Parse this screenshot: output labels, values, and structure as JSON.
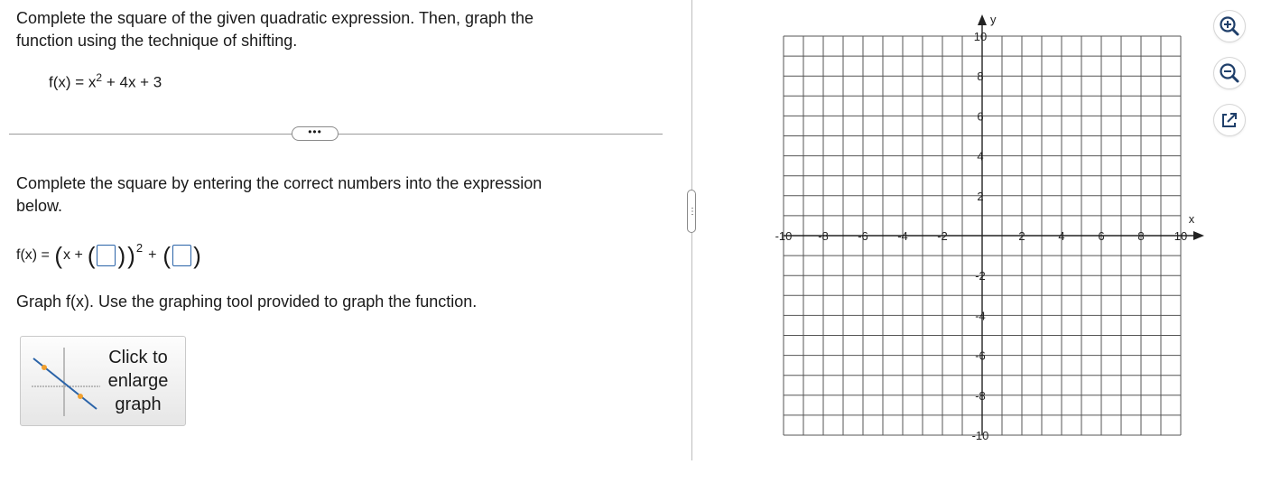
{
  "question": {
    "instruction_line1": "Complete the square of the given quadratic expression. Then, graph the",
    "instruction_line2": "function using the technique of shifting.",
    "function_lhs": "f(x) = x",
    "function_exp": "2",
    "function_rest": " + 4x + 3",
    "more_label": "•••",
    "step1_line1": "Complete the square by entering the correct numbers into the expression",
    "step1_line2": "below.",
    "expr_prefix": "f(x) = ",
    "expr_x": "x +",
    "expr_exp": "2",
    "expr_plus": "+",
    "box1_value": "",
    "box2_value": "",
    "step2": "Graph f(x). Use the graphing tool provided to graph the function.",
    "enlarge_line1": "Click to",
    "enlarge_line2": "enlarge",
    "enlarge_line3": "graph"
  },
  "splitter": {
    "label": "⋮"
  },
  "graph": {
    "x_label": "x",
    "y_label": "y",
    "x_ticks": [
      "-10",
      "-8",
      "-6",
      "-4",
      "-2",
      "2",
      "4",
      "6",
      "8",
      "10"
    ],
    "y_ticks": [
      "10",
      "8",
      "6",
      "4",
      "2",
      "-2",
      "-4",
      "-6",
      "-8",
      "-10"
    ],
    "xlim": [
      -10,
      10
    ],
    "ylim": [
      -10,
      10
    ],
    "grid_step": 1,
    "grid_color": "#555555",
    "axis_color": "#222222"
  },
  "tools": [
    "zoom-in-icon",
    "zoom-out-icon",
    "external-link-icon"
  ],
  "colors": {
    "accent": "#2a63a8",
    "point": "#f0a030",
    "tool_icon": "#1f3f6a"
  }
}
